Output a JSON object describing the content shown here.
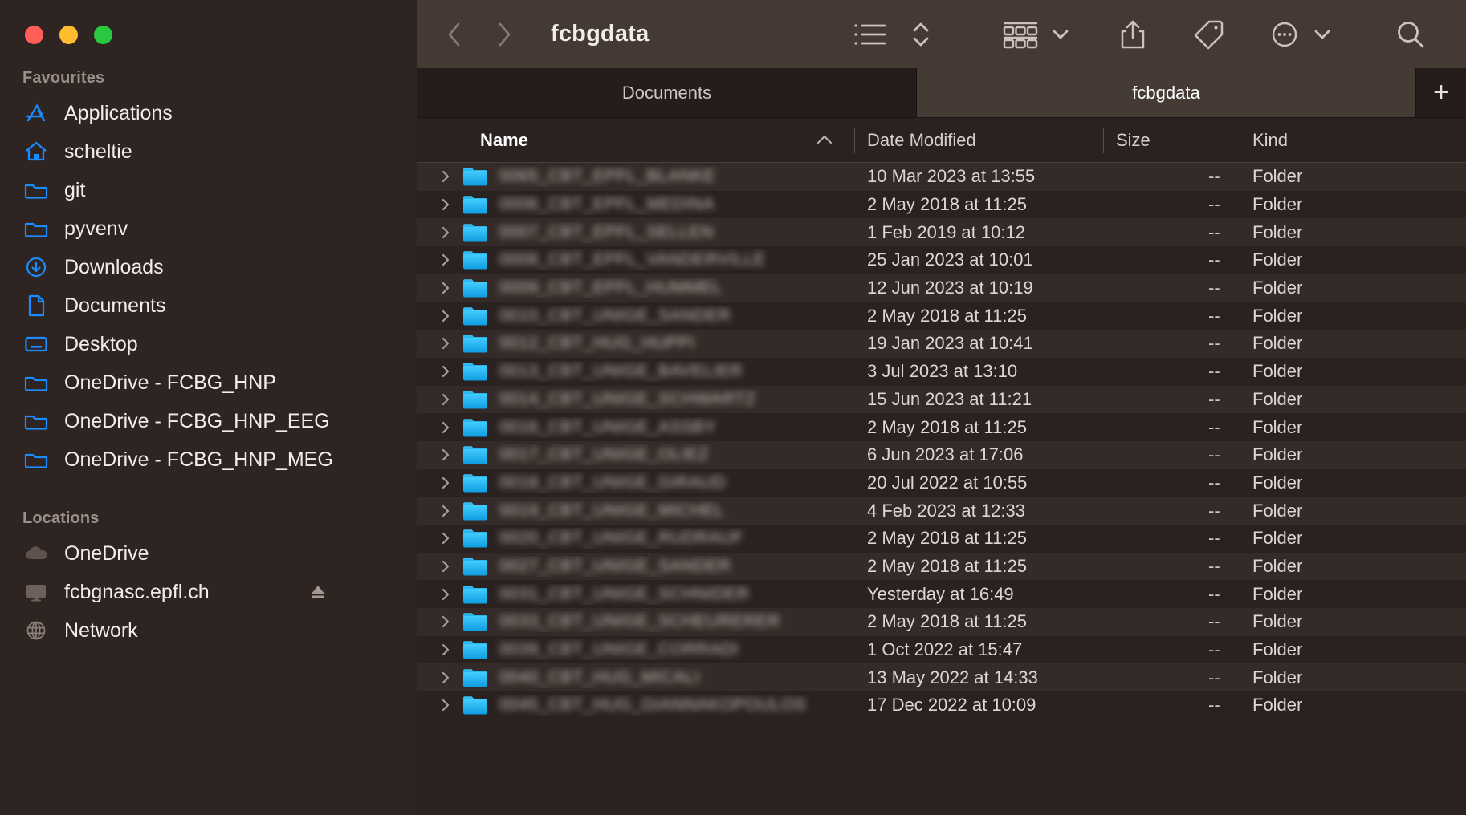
{
  "window": {
    "traffic_lights": [
      "close",
      "minimize",
      "zoom"
    ],
    "colors": {
      "close": "#ff5f57",
      "minimize": "#febc2e",
      "zoom": "#28c840",
      "accent_blue": "#1a8cff",
      "sidebar_bg": "#2e2523",
      "main_bg": "#2a2220",
      "toolbar_bg": "#443933",
      "row_stripe": "#342a27"
    }
  },
  "sidebar": {
    "sections": [
      {
        "title": "Favourites",
        "items": [
          {
            "label": "Applications",
            "icon": "applications-icon"
          },
          {
            "label": "scheltie",
            "icon": "home-icon"
          },
          {
            "label": "git",
            "icon": "folder-icon"
          },
          {
            "label": "pyvenv",
            "icon": "folder-icon"
          },
          {
            "label": "Downloads",
            "icon": "downloads-icon"
          },
          {
            "label": "Documents",
            "icon": "document-icon"
          },
          {
            "label": "Desktop",
            "icon": "desktop-icon"
          },
          {
            "label": "OneDrive - FCBG_HNP",
            "icon": "folder-icon"
          },
          {
            "label": "OneDrive - FCBG_HNP_EEG",
            "icon": "folder-icon"
          },
          {
            "label": "OneDrive - FCBG_HNP_MEG",
            "icon": "folder-icon"
          }
        ]
      },
      {
        "title": "Locations",
        "items": [
          {
            "label": "OneDrive",
            "icon": "cloud-icon"
          },
          {
            "label": "fcbgnasc.epfl.ch",
            "icon": "display-icon",
            "eject": true
          },
          {
            "label": "Network",
            "icon": "globe-icon"
          }
        ]
      }
    ]
  },
  "toolbar": {
    "back_label": "Back",
    "forward_label": "Forward",
    "title": "fcbgdata",
    "buttons": [
      {
        "name": "view-as-list-icon",
        "label": "View as List"
      },
      {
        "name": "sort-chevrons-icon",
        "label": "Sort"
      },
      {
        "name": "group-view-icon",
        "label": "Group"
      },
      {
        "name": "share-icon",
        "label": "Share"
      },
      {
        "name": "tag-icon",
        "label": "Tags"
      },
      {
        "name": "more-actions-icon",
        "label": "More"
      },
      {
        "name": "search-icon",
        "label": "Search"
      }
    ]
  },
  "tabs": {
    "items": [
      {
        "label": "Documents",
        "active": false
      },
      {
        "label": "fcbgdata",
        "active": true
      }
    ],
    "add_label": "+"
  },
  "columns": {
    "name": "Name",
    "date_modified": "Date Modified",
    "size": "Size",
    "kind": "Kind",
    "sort_column": "Name",
    "sort_direction": "ascending"
  },
  "files": [
    {
      "name": "0065_CBT_EPFL_BLANKE",
      "date": "10 Mar 2023 at 13:55",
      "size": "--",
      "kind": "Folder"
    },
    {
      "name": "0006_CBT_EPFL_MEDINA",
      "date": "2 May 2018 at 11:25",
      "size": "--",
      "kind": "Folder"
    },
    {
      "name": "0007_CBT_EPFL_SELLEN",
      "date": "1 Feb 2019 at 10:12",
      "size": "--",
      "kind": "Folder"
    },
    {
      "name": "0008_CBT_EPFL_VANDERVILLE",
      "date": "25 Jan 2023 at 10:01",
      "size": "--",
      "kind": "Folder"
    },
    {
      "name": "0009_CBT_EPFL_HUMMEL",
      "date": "12 Jun 2023 at 10:19",
      "size": "--",
      "kind": "Folder"
    },
    {
      "name": "0010_CBT_UNIGE_SANDER",
      "date": "2 May 2018 at 11:25",
      "size": "--",
      "kind": "Folder"
    },
    {
      "name": "0012_CBT_HUG_HUPPI",
      "date": "19 Jan 2023 at 10:41",
      "size": "--",
      "kind": "Folder"
    },
    {
      "name": "0013_CBT_UNIGE_BAVELIER",
      "date": "3 Jul 2023 at 13:10",
      "size": "--",
      "kind": "Folder"
    },
    {
      "name": "0014_CBT_UNIGE_SCHWARTZ",
      "date": "15 Jun 2023 at 11:21",
      "size": "--",
      "kind": "Folder"
    },
    {
      "name": "0016_CBT_UNIGE_ASSBY",
      "date": "2 May 2018 at 11:25",
      "size": "--",
      "kind": "Folder"
    },
    {
      "name": "0017_CBT_UNIGE_OLIEZ",
      "date": "6 Jun 2023 at 17:06",
      "size": "--",
      "kind": "Folder"
    },
    {
      "name": "0018_CBT_UNIGE_GIRAUD",
      "date": "20 Jul 2022 at 10:55",
      "size": "--",
      "kind": "Folder"
    },
    {
      "name": "0019_CBT_UNIGE_MICHEL",
      "date": "4 Feb 2023 at 12:33",
      "size": "--",
      "kind": "Folder"
    },
    {
      "name": "0020_CBT_UNIGE_RUDRAUF",
      "date": "2 May 2018 at 11:25",
      "size": "--",
      "kind": "Folder"
    },
    {
      "name": "0027_CBT_UNIGE_SANDER",
      "date": "2 May 2018 at 11:25",
      "size": "--",
      "kind": "Folder"
    },
    {
      "name": "0031_CBT_UNIGE_SCHNIDER",
      "date": "Yesterday at 16:49",
      "size": "--",
      "kind": "Folder"
    },
    {
      "name": "0033_CBT_UNIGE_SCHEURERER",
      "date": "2 May 2018 at 11:25",
      "size": "--",
      "kind": "Folder"
    },
    {
      "name": "0039_CBT_UNIGE_CORRADI",
      "date": "1 Oct 2022 at 15:47",
      "size": "--",
      "kind": "Folder"
    },
    {
      "name": "0040_CBT_HUG_MICALI",
      "date": "13 May 2022 at 14:33",
      "size": "--",
      "kind": "Folder"
    },
    {
      "name": "0045_CBT_HUG_GIANNAKOPOULOS",
      "date": "17 Dec 2022 at 10:09",
      "size": "--",
      "kind": "Folder"
    }
  ]
}
